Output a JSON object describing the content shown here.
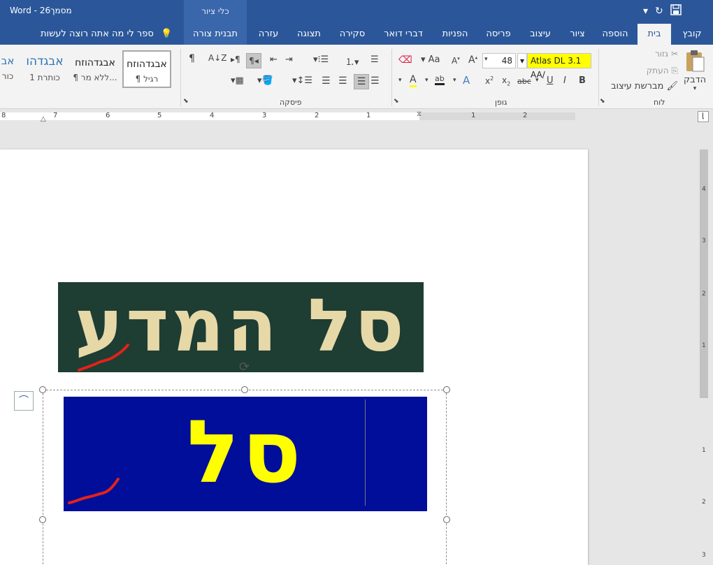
{
  "titlebar": {
    "app": "Word",
    "document": "מסמך26",
    "separator": " - ",
    "context_tools": "כלי ציור"
  },
  "tabs": {
    "file": "קובץ",
    "home": "בית",
    "insert": "הוספה",
    "draw": "ציור",
    "design": "עיצוב",
    "layout": "פריסה",
    "references": "הפניות",
    "mailings": "דברי דואר",
    "review": "סקירה",
    "view": "תצוגה",
    "help": "עזרה",
    "shape_format": "תבנית צורה"
  },
  "tellme": "ספר לי מה אתה רוצה לעשות",
  "ribbon": {
    "clipboard": {
      "label": "לוח",
      "paste": "הדבק",
      "cut": "גזור",
      "copy": "העתק",
      "format_painter": "מברשת עיצוב"
    },
    "font": {
      "label": "גופן",
      "font_name": "Atlas DL 3.1 AA/",
      "font_size": "48"
    },
    "paragraph": {
      "label": "פיסקה"
    },
    "styles": {
      "normal_preview": "אבגדהוזח",
      "normal": "¶ רגיל",
      "nospacing_preview": "אבגדהוזח",
      "nospacing": "¶ ללא מר...",
      "heading1_preview": "אבגדהו",
      "heading1": "כותרת 1",
      "heading2_preview": "אב",
      "heading2": "כור"
    }
  },
  "ruler": {
    "marks": [
      "2",
      "1",
      "1",
      "2",
      "3",
      "4",
      "5",
      "6",
      "7",
      "8"
    ],
    "vmarks": [
      "4",
      "3",
      "2",
      "1",
      "1",
      "2",
      "3"
    ]
  },
  "document": {
    "image1_text": "סל המדע",
    "image2_text": "סל המדע"
  },
  "colors": {
    "titlebar": "#2b579a",
    "image1_bg": "#1e3d33",
    "image1_text": "#e7d8a8",
    "image2_bg": "#000e9a",
    "image2_text": "#ffff00",
    "squiggle": "#e0231b"
  }
}
